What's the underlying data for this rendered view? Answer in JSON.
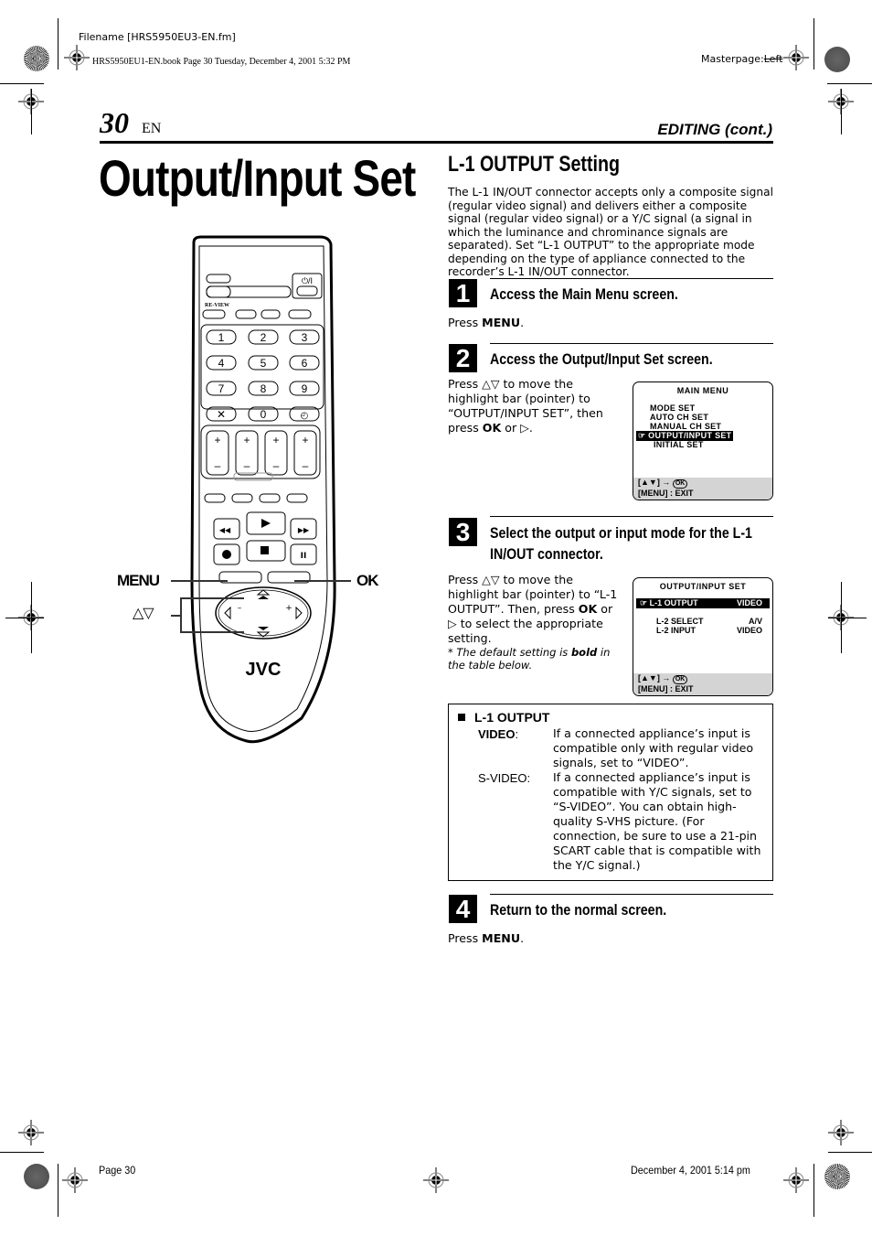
{
  "print_meta": {
    "filename": "Filename [HRS5950EU3-EN.fm]",
    "book_line": "HRS5950EU1-EN.book  Page 30  Tuesday, December 4, 2001  5:32 PM",
    "masterpage_prefix": "Masterpage:",
    "masterpage_value": "Left"
  },
  "header": {
    "page_number": "30",
    "language": "EN",
    "section": "EDITING (cont.)"
  },
  "main_title": "Output/Input Set",
  "remote": {
    "brand": "JVC",
    "keypad": [
      "1",
      "2",
      "3",
      "4",
      "5",
      "6",
      "7",
      "8",
      "9",
      "0"
    ],
    "review_label": "RE-VIEW",
    "power_label": "⏻/I",
    "callouts": {
      "menu": "MENU",
      "ok": "OK",
      "arrows": "△▽"
    }
  },
  "section": {
    "title": "L-1 OUTPUT Setting",
    "intro": "The L-1 IN/OUT connector accepts only a composite signal (regular video signal) and delivers either a composite signal (regular video signal) or a Y/C signal (a signal in which the luminance and chrominance signals are separated). Set “L-1 OUTPUT” to the appropriate mode depending on the type of appliance connected to the recorder’s L-1 IN/OUT connector."
  },
  "steps": [
    {
      "number": "1",
      "title": "Access the Main Menu screen.",
      "body_prefix": "Press ",
      "body_key": "MENU",
      "body_suffix": "."
    },
    {
      "number": "2",
      "title": "Access the Output/Input Set screen.",
      "body_a": "Press △▽ to move the highlight bar (pointer) to “OUTPUT/INPUT SET”, then press ",
      "body_key": "OK",
      "body_b": " or ▷."
    },
    {
      "number": "3",
      "title_line1": "Select the output or input mode for the L-1",
      "title_line2": "IN/OUT connector.",
      "body_a": "Press △▽ to move the highlight bar (pointer) to “L-1 OUTPUT”. Then, press ",
      "body_key": "OK",
      "body_b": " or ▷ to select the appropriate setting.",
      "note_a": "*  The default setting is ",
      "note_bold": "bold",
      "note_b": " in the table below."
    },
    {
      "number": "4",
      "title": "Return to the normal screen.",
      "body_prefix": "Press ",
      "body_key": "MENU",
      "body_suffix": "."
    }
  ],
  "osd_main_menu": {
    "title": "MAIN MENU",
    "items": [
      "MODE SET",
      "AUTO CH SET",
      "MANUAL CH SET",
      "OUTPUT/INPUT SET",
      "INITIAL SET"
    ],
    "selected_index": 3,
    "footer_line1": "[▲▼] → ",
    "footer_ok": "OK",
    "footer_line2": "[MENU] : EXIT"
  },
  "osd_output_input": {
    "title": "OUTPUT/INPUT SET",
    "rows": [
      {
        "label": "L-1 OUTPUT",
        "value": "VIDEO",
        "selected": true
      },
      {
        "label": "L-2 SELECT",
        "value": "A/V",
        "selected": false
      },
      {
        "label": "L-2 INPUT",
        "value": "VIDEO",
        "selected": false
      }
    ],
    "footer_line1": "[▲▼] → ",
    "footer_ok": "OK",
    "footer_line2": "[MENU] : EXIT"
  },
  "options_table": {
    "title": "L-1 OUTPUT",
    "options": [
      {
        "label": "VIDEO",
        "suffix": ":",
        "default": true,
        "description": "If a connected appliance’s input is compatible only with regular video signals, set to “VIDEO”."
      },
      {
        "label": "S-VIDEO:",
        "suffix": "",
        "default": false,
        "description": "If a connected appliance’s input is compatible with Y/C signals, set to “S-VIDEO”. You can obtain high-quality S-VHS picture. (For connection, be sure to use a 21-pin SCART cable that is compatible with the Y/C signal.)"
      }
    ]
  },
  "footer": {
    "page": "Page 30",
    "timestamp": "December 4, 2001 5:14 pm"
  }
}
